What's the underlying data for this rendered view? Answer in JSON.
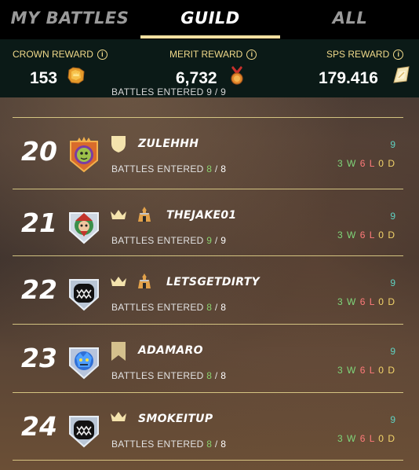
{
  "tabs": [
    {
      "label": "MY BATTLES",
      "active": false
    },
    {
      "label": "GUILD",
      "active": true
    },
    {
      "label": "ALL",
      "active": false
    }
  ],
  "rewards": {
    "crown": {
      "label": "CROWN REWARD",
      "value": "153",
      "icon": "crown-token-icon"
    },
    "merit": {
      "label": "MERIT REWARD",
      "value": "6,732",
      "icon": "merit-medal-icon"
    },
    "sps": {
      "label": "SPS REWARD",
      "value": "179.416",
      "icon": "sps-token-icon"
    },
    "info_glyph": "i"
  },
  "cutoff_text": "BATTLES ENTERED 9 / 9",
  "rows": [
    {
      "rank": "20",
      "name": "ZULEHHH",
      "battles_label": "BATTLES ENTERED",
      "entered": "8",
      "total": "8",
      "score": "9",
      "wins": "3",
      "losses": "6",
      "draws": "0",
      "w": "W",
      "l": "L",
      "d": "D",
      "sep": "/"
    },
    {
      "rank": "21",
      "name": "THEJAKE01",
      "battles_label": "BATTLES ENTERED",
      "entered": "9",
      "total": "9",
      "score": "9",
      "wins": "3",
      "losses": "6",
      "draws": "0",
      "w": "W",
      "l": "L",
      "d": "D",
      "sep": "/"
    },
    {
      "rank": "22",
      "name": "LETSGETDIRTY",
      "battles_label": "BATTLES ENTERED",
      "entered": "8",
      "total": "8",
      "score": "9",
      "wins": "3",
      "losses": "6",
      "draws": "0",
      "w": "W",
      "l": "L",
      "d": "D",
      "sep": "/"
    },
    {
      "rank": "23",
      "name": "ADAMARO",
      "battles_label": "BATTLES ENTERED",
      "entered": "8",
      "total": "8",
      "score": "9",
      "wins": "3",
      "losses": "6",
      "draws": "0",
      "w": "W",
      "l": "L",
      "d": "D",
      "sep": "/"
    },
    {
      "rank": "24",
      "name": "SMOKEITUP",
      "battles_label": "BATTLES ENTERED",
      "entered": "8",
      "total": "8",
      "score": "9",
      "wins": "3",
      "losses": "6",
      "draws": "0",
      "w": "W",
      "l": "L",
      "d": "D",
      "sep": "/"
    }
  ],
  "colors": {
    "accent_gold": "#f1dfa0",
    "score_teal": "#5fd3c3",
    "win_green": "#7fd67a",
    "loss_red": "#ff7a7a",
    "draw_yellow": "#f3d46a"
  }
}
